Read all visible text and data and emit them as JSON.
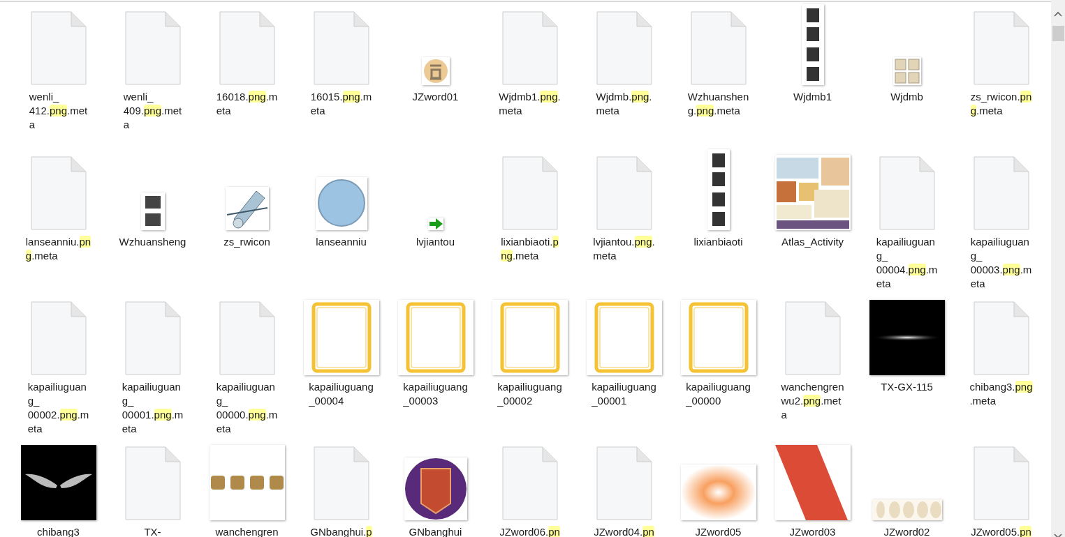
{
  "files": [
    {
      "kind": "document",
      "lines": [
        [
          {
            "text": "wenli_",
            "highlighted": false
          }
        ],
        [
          {
            "text": "412.",
            "highlighted": false
          },
          {
            "text": "png",
            "highlighted": true
          },
          {
            "text": ".met",
            "highlighted": false
          }
        ],
        [
          {
            "text": "a",
            "highlighted": false
          }
        ]
      ]
    },
    {
      "kind": "document",
      "lines": [
        [
          {
            "text": "wenli_",
            "highlighted": false
          }
        ],
        [
          {
            "text": "409.",
            "highlighted": false
          },
          {
            "text": "png",
            "highlighted": true
          },
          {
            "text": ".met",
            "highlighted": false
          }
        ],
        [
          {
            "text": "a",
            "highlighted": false
          }
        ]
      ]
    },
    {
      "kind": "document",
      "lines": [
        [
          {
            "text": "16018.",
            "highlighted": false
          },
          {
            "text": "png",
            "highlighted": true
          },
          {
            "text": ".m",
            "highlighted": false
          }
        ],
        [
          {
            "text": "eta",
            "highlighted": false
          }
        ]
      ]
    },
    {
      "kind": "document",
      "lines": [
        [
          {
            "text": "16015.",
            "highlighted": false
          },
          {
            "text": "png",
            "highlighted": true
          },
          {
            "text": ".m",
            "highlighted": false
          }
        ],
        [
          {
            "text": "eta",
            "highlighted": false
          }
        ]
      ]
    },
    {
      "kind": "seal",
      "lines": [
        [
          {
            "text": "JZword01",
            "highlighted": false
          }
        ]
      ]
    },
    {
      "kind": "document",
      "lines": [
        [
          {
            "text": "Wjdmb1.",
            "highlighted": false
          },
          {
            "text": "png",
            "highlighted": true
          },
          {
            "text": ".",
            "highlighted": false
          }
        ],
        [
          {
            "text": "meta",
            "highlighted": false
          }
        ]
      ]
    },
    {
      "kind": "document",
      "lines": [
        [
          {
            "text": "Wjdmb.",
            "highlighted": false
          },
          {
            "text": "png",
            "highlighted": true
          },
          {
            "text": ".",
            "highlighted": false
          }
        ],
        [
          {
            "text": "meta",
            "highlighted": false
          }
        ]
      ]
    },
    {
      "kind": "document",
      "lines": [
        [
          {
            "text": "Wzhuanshen",
            "highlighted": false
          }
        ],
        [
          {
            "text": "g.",
            "highlighted": false
          },
          {
            "text": "png",
            "highlighted": true
          },
          {
            "text": ".meta",
            "highlighted": false
          }
        ]
      ]
    },
    {
      "kind": "vertical-banner",
      "lines": [
        [
          {
            "text": "Wjdmb1",
            "highlighted": false
          }
        ]
      ]
    },
    {
      "kind": "small-label",
      "lines": [
        [
          {
            "text": "Wjdmb",
            "highlighted": false
          }
        ]
      ]
    },
    {
      "kind": "document",
      "lines": [
        [
          {
            "text": "zs_rwicon.",
            "highlighted": false
          },
          {
            "text": "pn",
            "highlighted": true
          }
        ],
        [
          {
            "text": "g",
            "highlighted": true
          },
          {
            "text": ".meta",
            "highlighted": false
          }
        ]
      ]
    },
    {
      "kind": "document",
      "lines": [
        [
          {
            "text": "lanseanniu.",
            "highlighted": false
          },
          {
            "text": "pn",
            "highlighted": true
          }
        ],
        [
          {
            "text": "g",
            "highlighted": true
          },
          {
            "text": ".meta",
            "highlighted": false
          }
        ]
      ]
    },
    {
      "kind": "tile",
      "lines": [
        [
          {
            "text": "Wzhuansheng",
            "highlighted": false
          }
        ]
      ]
    },
    {
      "kind": "scroll",
      "lines": [
        [
          {
            "text": "zs_rwicon",
            "highlighted": false
          }
        ]
      ]
    },
    {
      "kind": "circle-button",
      "lines": [
        [
          {
            "text": "lanseanniu",
            "highlighted": false
          }
        ]
      ]
    },
    {
      "kind": "arrow",
      "lines": [
        [
          {
            "text": "lvjiantou",
            "highlighted": false
          }
        ]
      ]
    },
    {
      "kind": "document",
      "lines": [
        [
          {
            "text": "lixianbiaoti.",
            "highlighted": false
          },
          {
            "text": "p",
            "highlighted": true
          }
        ],
        [
          {
            "text": "ng",
            "highlighted": true
          },
          {
            "text": ".meta",
            "highlighted": false
          }
        ]
      ]
    },
    {
      "kind": "document",
      "lines": [
        [
          {
            "text": "lvjiantou.",
            "highlighted": false
          },
          {
            "text": "png",
            "highlighted": true
          },
          {
            "text": ".",
            "highlighted": false
          }
        ],
        [
          {
            "text": "meta",
            "highlighted": false
          }
        ]
      ]
    },
    {
      "kind": "vertical-banner",
      "lines": [
        [
          {
            "text": "lixianbiaoti",
            "highlighted": false
          }
        ]
      ]
    },
    {
      "kind": "atlas",
      "lines": [
        [
          {
            "text": "Atlas_Activity",
            "highlighted": false
          }
        ]
      ]
    },
    {
      "kind": "document",
      "lines": [
        [
          {
            "text": "kapailiuguan",
            "highlighted": false
          }
        ],
        [
          {
            "text": "g_",
            "highlighted": false
          }
        ],
        [
          {
            "text": "00004.",
            "highlighted": false
          },
          {
            "text": "png",
            "highlighted": true
          },
          {
            "text": ".m",
            "highlighted": false
          }
        ],
        [
          {
            "text": "eta",
            "highlighted": false
          }
        ]
      ]
    },
    {
      "kind": "document",
      "lines": [
        [
          {
            "text": "kapailiuguan",
            "highlighted": false
          }
        ],
        [
          {
            "text": "g_",
            "highlighted": false
          }
        ],
        [
          {
            "text": "00003.",
            "highlighted": false
          },
          {
            "text": "png",
            "highlighted": true
          },
          {
            "text": ".m",
            "highlighted": false
          }
        ],
        [
          {
            "text": "eta",
            "highlighted": false
          }
        ]
      ]
    },
    {
      "kind": "document",
      "lines": [
        [
          {
            "text": "kapailiuguan",
            "highlighted": false
          }
        ],
        [
          {
            "text": "g_",
            "highlighted": false
          }
        ],
        [
          {
            "text": "00002.",
            "highlighted": false
          },
          {
            "text": "png",
            "highlighted": true
          },
          {
            "text": ".m",
            "highlighted": false
          }
        ],
        [
          {
            "text": "eta",
            "highlighted": false
          }
        ]
      ]
    },
    {
      "kind": "document",
      "lines": [
        [
          {
            "text": "kapailiuguan",
            "highlighted": false
          }
        ],
        [
          {
            "text": "g_",
            "highlighted": false
          }
        ],
        [
          {
            "text": "00001.",
            "highlighted": false
          },
          {
            "text": "png",
            "highlighted": true
          },
          {
            "text": ".m",
            "highlighted": false
          }
        ],
        [
          {
            "text": "eta",
            "highlighted": false
          }
        ]
      ]
    },
    {
      "kind": "document",
      "lines": [
        [
          {
            "text": "kapailiuguan",
            "highlighted": false
          }
        ],
        [
          {
            "text": "g_",
            "highlighted": false
          }
        ],
        [
          {
            "text": "00000.",
            "highlighted": false
          },
          {
            "text": "png",
            "highlighted": true
          },
          {
            "text": ".m",
            "highlighted": false
          }
        ],
        [
          {
            "text": "eta",
            "highlighted": false
          }
        ]
      ]
    },
    {
      "kind": "frame",
      "lines": [
        [
          {
            "text": "kapailiuguang",
            "highlighted": false
          }
        ],
        [
          {
            "text": "_00004",
            "highlighted": false
          }
        ]
      ]
    },
    {
      "kind": "frame",
      "lines": [
        [
          {
            "text": "kapailiuguang",
            "highlighted": false
          }
        ],
        [
          {
            "text": "_00003",
            "highlighted": false
          }
        ]
      ]
    },
    {
      "kind": "frame",
      "lines": [
        [
          {
            "text": "kapailiuguang",
            "highlighted": false
          }
        ],
        [
          {
            "text": "_00002",
            "highlighted": false
          }
        ]
      ]
    },
    {
      "kind": "frame",
      "lines": [
        [
          {
            "text": "kapailiuguang",
            "highlighted": false
          }
        ],
        [
          {
            "text": "_00001",
            "highlighted": false
          }
        ]
      ]
    },
    {
      "kind": "frame",
      "lines": [
        [
          {
            "text": "kapailiuguang",
            "highlighted": false
          }
        ],
        [
          {
            "text": "_00000",
            "highlighted": false
          }
        ]
      ]
    },
    {
      "kind": "document",
      "lines": [
        [
          {
            "text": "wanchengren",
            "highlighted": false
          }
        ],
        [
          {
            "text": "wu2.",
            "highlighted": false
          },
          {
            "text": "png",
            "highlighted": true
          },
          {
            "text": ".met",
            "highlighted": false
          }
        ],
        [
          {
            "text": "a",
            "highlighted": false
          }
        ]
      ]
    },
    {
      "kind": "flare",
      "lines": [
        [
          {
            "text": "TX-GX-115",
            "highlighted": false
          }
        ]
      ]
    },
    {
      "kind": "document",
      "lines": [
        [
          {
            "text": "chibang3.",
            "highlighted": false
          },
          {
            "text": "png",
            "highlighted": true
          }
        ],
        [
          {
            "text": ".meta",
            "highlighted": false
          }
        ]
      ]
    },
    {
      "kind": "wings",
      "lines": [
        [
          {
            "text": "chibang3",
            "highlighted": false
          }
        ]
      ]
    },
    {
      "kind": "document",
      "lines": [
        [
          {
            "text": "TX-",
            "highlighted": false
          }
        ]
      ]
    },
    {
      "kind": "calligraphy",
      "lines": [
        [
          {
            "text": "wanchengren",
            "highlighted": false
          }
        ]
      ]
    },
    {
      "kind": "document",
      "lines": [
        [
          {
            "text": "GNbanghui.",
            "highlighted": false
          },
          {
            "text": "p",
            "highlighted": true
          }
        ]
      ]
    },
    {
      "kind": "emblem",
      "lines": [
        [
          {
            "text": "GNbanghui",
            "highlighted": false
          }
        ]
      ]
    },
    {
      "kind": "document",
      "lines": [
        [
          {
            "text": "JZword06.",
            "highlighted": false
          },
          {
            "text": "pn",
            "highlighted": true
          }
        ]
      ]
    },
    {
      "kind": "document",
      "lines": [
        [
          {
            "text": "JZword04.",
            "highlighted": false
          },
          {
            "text": "pn",
            "highlighted": true
          }
        ]
      ]
    },
    {
      "kind": "burst",
      "lines": [
        [
          {
            "text": "JZword05",
            "highlighted": false
          }
        ]
      ]
    },
    {
      "kind": "stripe",
      "lines": [
        [
          {
            "text": "JZword03",
            "highlighted": false
          }
        ]
      ]
    },
    {
      "kind": "numerals",
      "lines": [
        [
          {
            "text": "JZword02",
            "highlighted": false
          }
        ]
      ]
    },
    {
      "kind": "document",
      "lines": [
        [
          {
            "text": "JZword05.",
            "highlighted": false
          },
          {
            "text": "pn",
            "highlighted": true
          }
        ]
      ]
    }
  ]
}
